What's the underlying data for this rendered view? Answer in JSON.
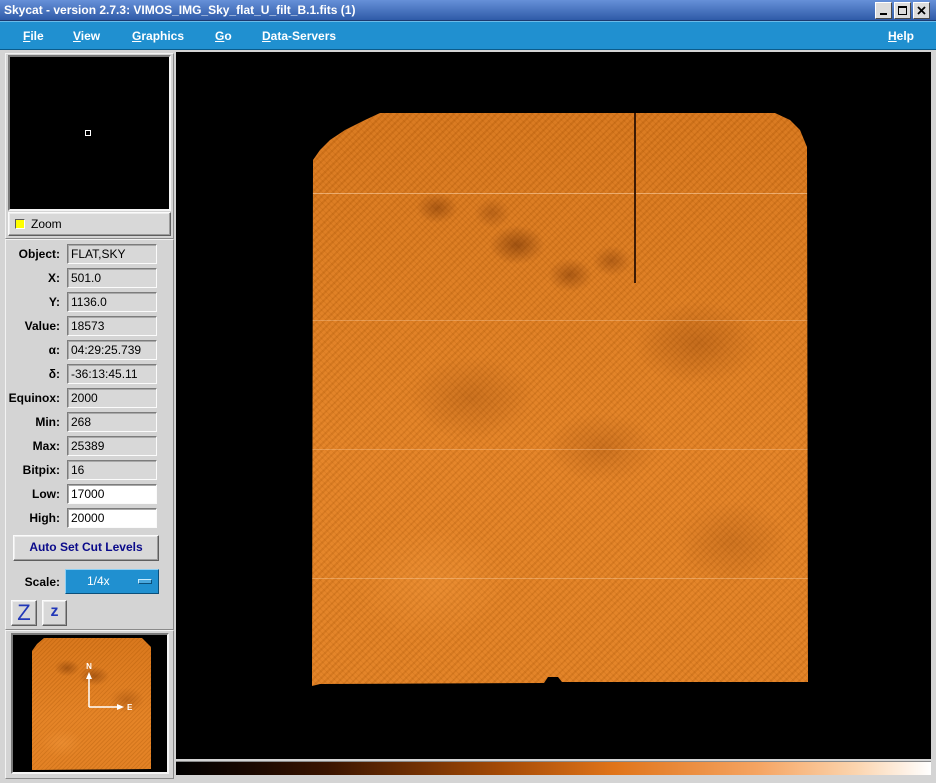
{
  "window": {
    "title": "Skycat - version 2.7.3: VIMOS_IMG_Sky_flat_U_filt_B.1.fits (1)",
    "icons": [
      "minimize-icon",
      "maximize-icon",
      "close-icon"
    ]
  },
  "menubar": {
    "items": [
      "File",
      "View",
      "Graphics",
      "Go",
      "Data-Servers"
    ],
    "help": "Help"
  },
  "zoom": {
    "label": "Zoom",
    "checked": true
  },
  "info": {
    "rows": [
      {
        "label": "Object:",
        "value": "FLAT,SKY"
      },
      {
        "label": "X:",
        "value": "501.0"
      },
      {
        "label": "Y:",
        "value": "1136.0"
      },
      {
        "label": "Value:",
        "value": "18573"
      },
      {
        "label": "α:",
        "value": "04:29:25.739"
      },
      {
        "label": "δ:",
        "value": "-36:13:45.11"
      },
      {
        "label": "Equinox:",
        "value": "2000"
      },
      {
        "label": "Min:",
        "value": "268"
      },
      {
        "label": "Max:",
        "value": "25389"
      },
      {
        "label": "Bitpix:",
        "value": "16"
      },
      {
        "label": "Low:",
        "value": "17000"
      },
      {
        "label": "High:",
        "value": "20000"
      }
    ]
  },
  "controls": {
    "auto_cut_label": "Auto Set Cut Levels"
  },
  "scale": {
    "label": "Scale:",
    "value": "1/4x",
    "indicator_icon": "menubutton-indicator-icon"
  },
  "zoom_buttons": {
    "zoom_in": "Z",
    "zoom_out": "z"
  },
  "panner": {
    "compass": {
      "north": "N",
      "east": "E"
    }
  },
  "colors": {
    "title_bar": "#2f5ba8",
    "menubar": "#2090d0",
    "panel": "#d4d4d4",
    "canvas": "#000000",
    "image": "#e07a1a",
    "zoom_indicator": "#ffff00",
    "button_text": "#0a0a8a"
  }
}
